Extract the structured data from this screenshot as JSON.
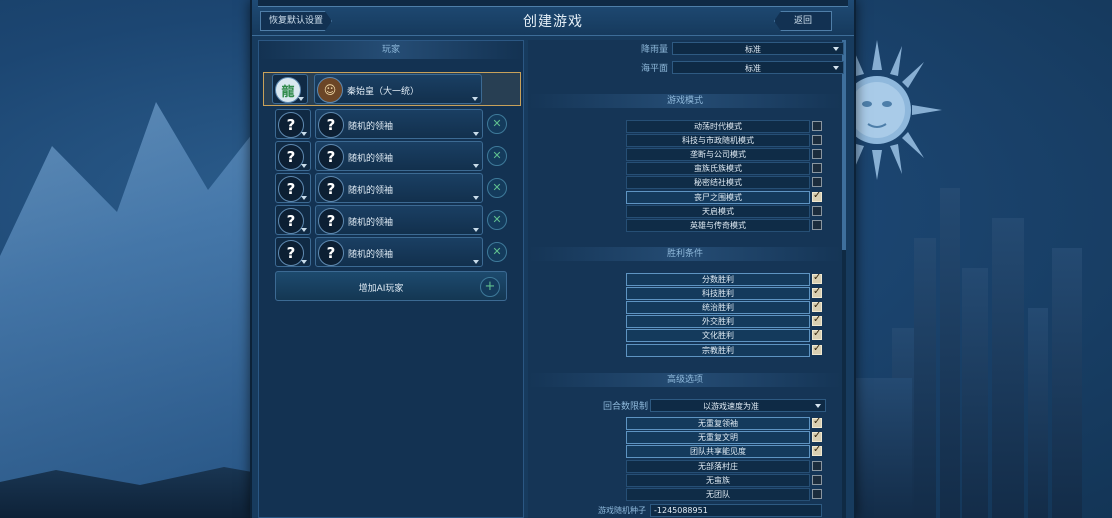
{
  "header": {
    "title": "创建游戏",
    "reset_label": "恢复默认设置",
    "back_label": "返回"
  },
  "players": {
    "section_title": "玩家",
    "human": {
      "leader": "秦始皇（大一统）"
    },
    "ai": [
      {
        "leader": "随机的领袖"
      },
      {
        "leader": "随机的领袖"
      },
      {
        "leader": "随机的领袖"
      },
      {
        "leader": "随机的领袖"
      },
      {
        "leader": "随机的领袖"
      }
    ],
    "add_ai_label": "增加AI玩家",
    "random_glyph": "?",
    "remove_glyph": "✕",
    "add_glyph": "+"
  },
  "map_options": [
    {
      "label": "降雨量",
      "value": "标准"
    },
    {
      "label": "海平面",
      "value": "标准"
    }
  ],
  "game_modes": {
    "title": "游戏模式",
    "items": [
      {
        "label": "动荡时代模式",
        "checked": false
      },
      {
        "label": "科技与市政随机模式",
        "checked": false
      },
      {
        "label": "垄断与公司模式",
        "checked": false
      },
      {
        "label": "蛮族氏族模式",
        "checked": false
      },
      {
        "label": "秘密结社模式",
        "checked": false
      },
      {
        "label": "丧尸之围模式",
        "checked": true
      },
      {
        "label": "天启模式",
        "checked": false
      },
      {
        "label": "英雄与传奇模式",
        "checked": false
      }
    ]
  },
  "victory": {
    "title": "胜利条件",
    "items": [
      {
        "label": "分数胜利",
        "checked": true
      },
      {
        "label": "科技胜利",
        "checked": true
      },
      {
        "label": "统治胜利",
        "checked": true
      },
      {
        "label": "外交胜利",
        "checked": true
      },
      {
        "label": "文化胜利",
        "checked": true
      },
      {
        "label": "宗教胜利",
        "checked": true
      }
    ]
  },
  "advanced": {
    "title": "高级选项",
    "turn_limit_label": "回合数限制",
    "turn_limit_value": "以游戏速度为准",
    "items": [
      {
        "label": "无重复领袖",
        "checked": true
      },
      {
        "label": "无重复文明",
        "checked": true
      },
      {
        "label": "团队共享能见度",
        "checked": true
      },
      {
        "label": "无部落村庄",
        "checked": false
      },
      {
        "label": "无蛮族",
        "checked": false
      },
      {
        "label": "无团队",
        "checked": false
      }
    ],
    "seed_label": "游戏随机种子",
    "seed_value": "-1245088951"
  },
  "colors": {
    "accent": "#c8a15a",
    "panel": "#173b5e",
    "check_on": "#d9cfb2"
  }
}
